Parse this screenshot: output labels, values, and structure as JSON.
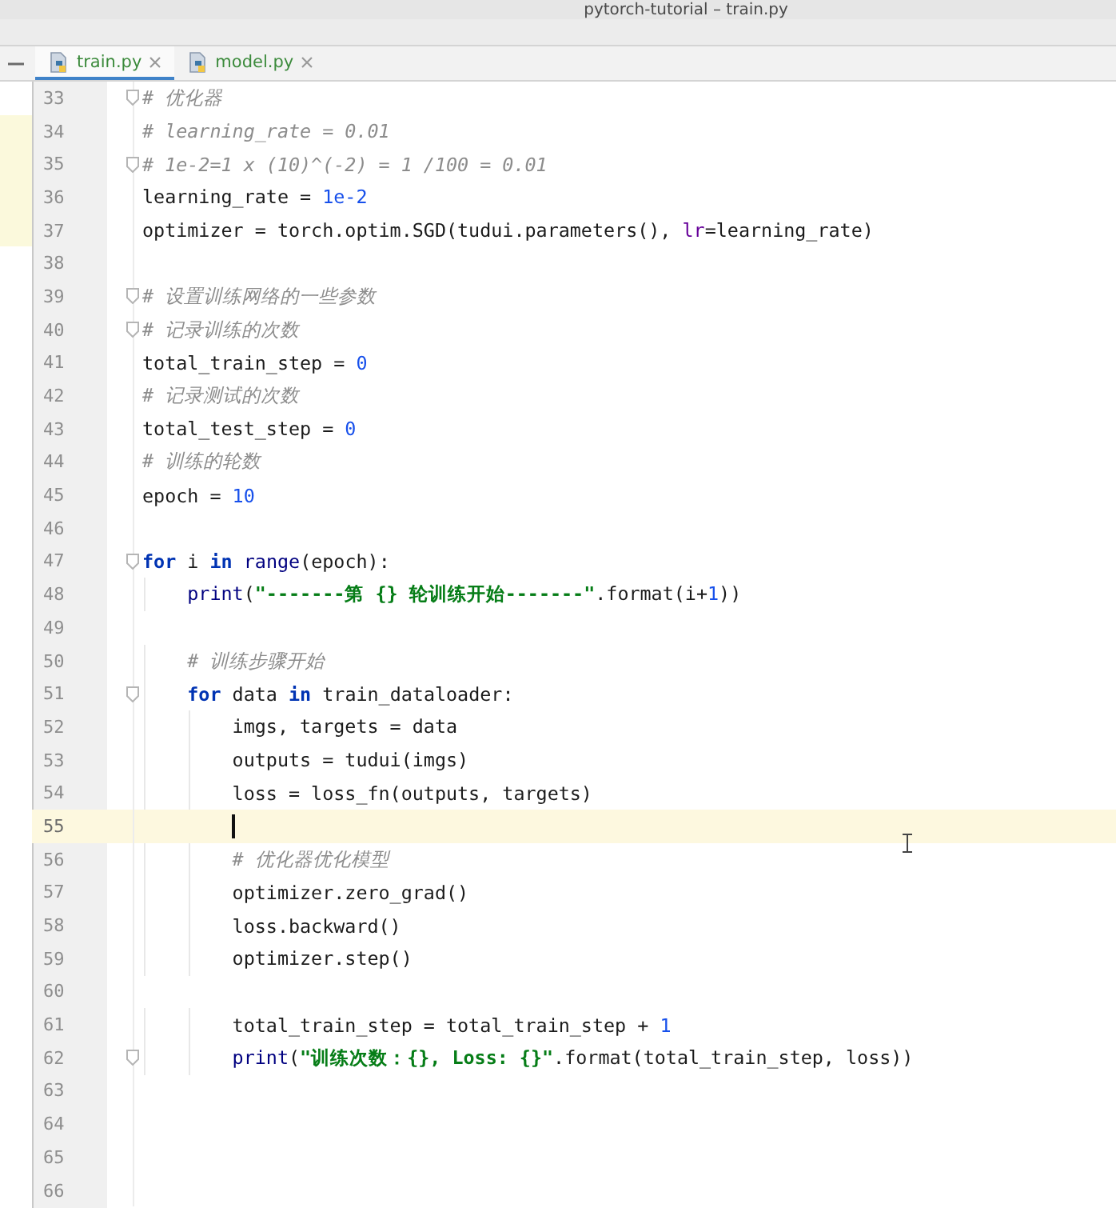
{
  "window": {
    "title": "pytorch-tutorial – train.py"
  },
  "tabs": [
    {
      "label": "train.py",
      "selected": true
    },
    {
      "label": "model.py",
      "selected": false
    }
  ],
  "lines": [
    {
      "number": "33",
      "fold": true,
      "modified": false,
      "current": false,
      "tokens": [
        {
          "kind": "comment",
          "text": "# 优化器"
        }
      ]
    },
    {
      "number": "34",
      "fold": false,
      "modified": true,
      "current": false,
      "tokens": [
        {
          "kind": "comment",
          "text": "# learning_rate = 0.01"
        }
      ]
    },
    {
      "number": "35",
      "fold": true,
      "modified": true,
      "current": false,
      "tokens": [
        {
          "kind": "comment",
          "text": "# 1e-2=1 x (10)^(-2) = 1 /100 = 0.01"
        }
      ]
    },
    {
      "number": "36",
      "fold": false,
      "modified": true,
      "current": false,
      "tokens": [
        {
          "kind": "plain",
          "text": "learning_rate = "
        },
        {
          "kind": "number",
          "text": "1e-2"
        }
      ]
    },
    {
      "number": "37",
      "fold": false,
      "modified": true,
      "current": false,
      "tokens": [
        {
          "kind": "plain",
          "text": "optimizer = torch.optim.SGD(tudui.parameters(), "
        },
        {
          "kind": "param",
          "text": "lr"
        },
        {
          "kind": "plain",
          "text": "=learning_rate)"
        }
      ]
    },
    {
      "number": "38",
      "fold": false,
      "modified": false,
      "current": false
    },
    {
      "number": "39",
      "fold": true,
      "modified": false,
      "current": false,
      "tokens": [
        {
          "kind": "comment",
          "text": "# 设置训练网络的一些参数"
        }
      ]
    },
    {
      "number": "40",
      "fold": true,
      "modified": false,
      "current": false,
      "tokens": [
        {
          "kind": "comment",
          "text": "# 记录训练的次数"
        }
      ]
    },
    {
      "number": "41",
      "fold": false,
      "modified": false,
      "current": false,
      "tokens": [
        {
          "kind": "plain",
          "text": "total_train_step = "
        },
        {
          "kind": "number",
          "text": "0"
        }
      ]
    },
    {
      "number": "42",
      "fold": false,
      "modified": false,
      "current": false,
      "tokens": [
        {
          "kind": "comment",
          "text": "# 记录测试的次数"
        }
      ]
    },
    {
      "number": "43",
      "fold": false,
      "modified": false,
      "current": false,
      "tokens": [
        {
          "kind": "plain",
          "text": "total_test_step = "
        },
        {
          "kind": "number",
          "text": "0"
        }
      ]
    },
    {
      "number": "44",
      "fold": false,
      "modified": false,
      "current": false,
      "tokens": [
        {
          "kind": "comment",
          "text": "# 训练的轮数"
        }
      ]
    },
    {
      "number": "45",
      "fold": false,
      "modified": false,
      "current": false,
      "tokens": [
        {
          "kind": "plain",
          "text": "epoch = "
        },
        {
          "kind": "number",
          "text": "10"
        }
      ]
    },
    {
      "number": "46",
      "fold": false,
      "modified": false,
      "current": false
    },
    {
      "number": "47",
      "fold": true,
      "modified": false,
      "current": false,
      "tokens": [
        {
          "kind": "keyword",
          "text": "for"
        },
        {
          "kind": "plain",
          "text": " i "
        },
        {
          "kind": "keyword",
          "text": "in "
        },
        {
          "kind": "builtin",
          "text": "range"
        },
        {
          "kind": "plain",
          "text": "(epoch):"
        }
      ]
    },
    {
      "number": "48",
      "fold": false,
      "modified": false,
      "current": false,
      "tokens": [
        {
          "kind": "builtin",
          "text": "    print"
        },
        {
          "kind": "plain",
          "text": "("
        },
        {
          "kind": "string",
          "text": "\"-------第 {} 轮训练开始-------\""
        },
        {
          "kind": "plain",
          "text": ".format(i+"
        },
        {
          "kind": "number",
          "text": "1"
        },
        {
          "kind": "plain",
          "text": "))"
        }
      ]
    },
    {
      "number": "49",
      "fold": false,
      "modified": false,
      "current": false
    },
    {
      "number": "50",
      "fold": false,
      "modified": false,
      "current": false,
      "tokens": [
        {
          "kind": "comment",
          "text": "    # 训练步骤开始"
        }
      ]
    },
    {
      "number": "51",
      "fold": true,
      "modified": false,
      "current": false,
      "tokens": [
        {
          "kind": "keyword",
          "text": "    for"
        },
        {
          "kind": "plain",
          "text": " data "
        },
        {
          "kind": "keyword",
          "text": "in"
        },
        {
          "kind": "plain",
          "text": " train_dataloader:"
        }
      ]
    },
    {
      "number": "52",
      "fold": false,
      "modified": false,
      "current": false,
      "tokens": [
        {
          "kind": "plain",
          "text": "        imgs, targets = data"
        }
      ]
    },
    {
      "number": "53",
      "fold": false,
      "modified": false,
      "current": false,
      "tokens": [
        {
          "kind": "plain",
          "text": "        outputs = tudui(imgs)"
        }
      ]
    },
    {
      "number": "54",
      "fold": false,
      "modified": false,
      "current": false,
      "tokens": [
        {
          "kind": "plain",
          "text": "        loss = loss_fn(outputs, targets)"
        }
      ]
    },
    {
      "number": "55",
      "fold": false,
      "modified": false,
      "current": true
    },
    {
      "number": "56",
      "fold": false,
      "modified": false,
      "current": false,
      "tokens": [
        {
          "kind": "comment",
          "text": "        # 优化器优化模型"
        }
      ]
    },
    {
      "number": "57",
      "fold": false,
      "modified": false,
      "current": false,
      "tokens": [
        {
          "kind": "plain",
          "text": "        optimizer.zero_grad()"
        }
      ]
    },
    {
      "number": "58",
      "fold": false,
      "modified": false,
      "current": false,
      "tokens": [
        {
          "kind": "plain",
          "text": "        loss.backward()"
        }
      ]
    },
    {
      "number": "59",
      "fold": false,
      "modified": false,
      "current": false,
      "tokens": [
        {
          "kind": "plain",
          "text": "        optimizer.step()"
        }
      ]
    },
    {
      "number": "60",
      "fold": false,
      "modified": false,
      "current": false
    },
    {
      "number": "61",
      "fold": false,
      "modified": false,
      "current": false,
      "tokens": [
        {
          "kind": "plain",
          "text": "        total_train_step = total_train_step + "
        },
        {
          "kind": "number",
          "text": "1"
        }
      ]
    },
    {
      "number": "62",
      "fold": true,
      "modified": false,
      "current": false,
      "tokens": [
        {
          "kind": "builtin",
          "text": "        print"
        },
        {
          "kind": "plain",
          "text": "("
        },
        {
          "kind": "string",
          "text": "\"训练次数：{}, Loss: {}\""
        },
        {
          "kind": "plain",
          "text": ".format(total_train_step, loss))"
        }
      ]
    },
    {
      "number": "63",
      "fold": false,
      "modified": false,
      "current": false
    },
    {
      "number": "64",
      "fold": false,
      "modified": false,
      "current": false
    },
    {
      "number": "65",
      "fold": false,
      "modified": false,
      "current": false
    },
    {
      "number": "66",
      "fold": false,
      "modified": false,
      "current": false
    }
  ]
}
